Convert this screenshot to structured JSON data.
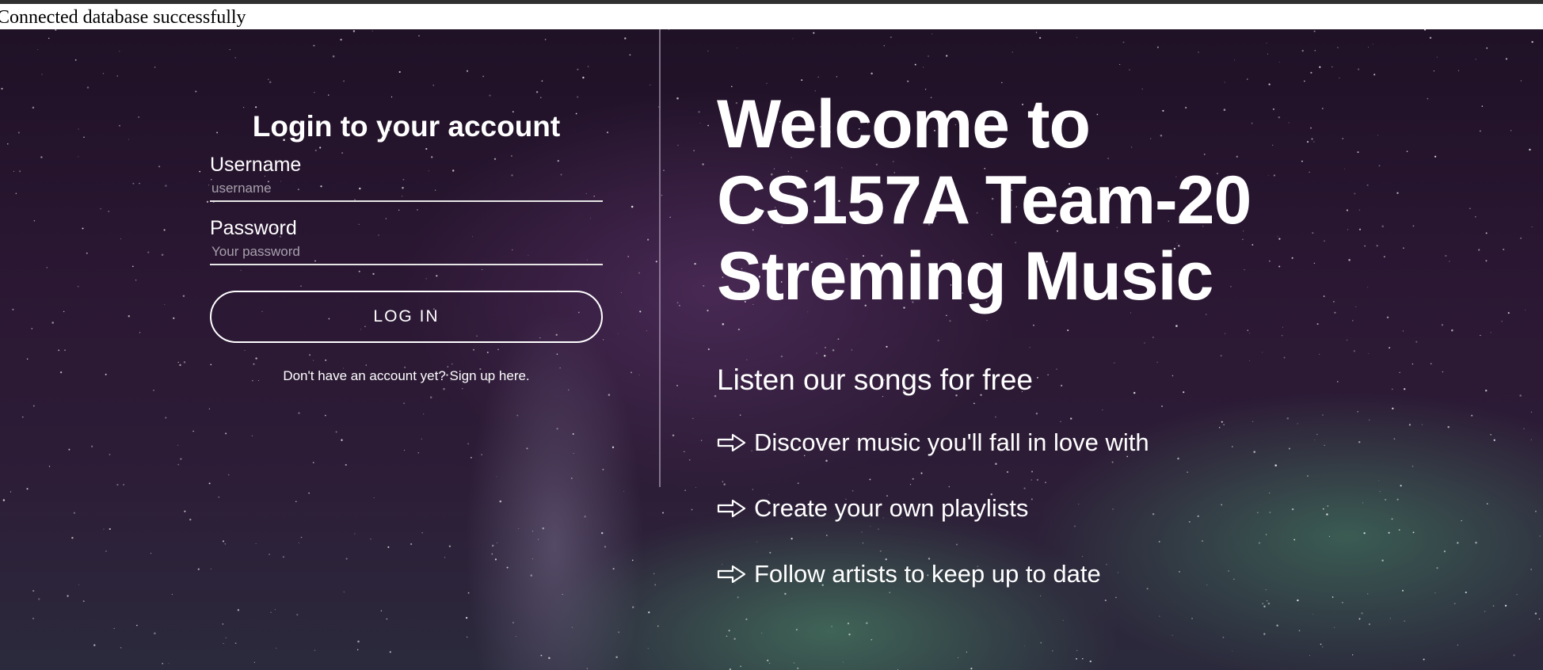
{
  "status": {
    "message": "Connected database successfully"
  },
  "login": {
    "title": "Login to your account",
    "username_label": "Username",
    "username_placeholder": "username",
    "password_label": "Password",
    "password_placeholder": "Your password",
    "button_label": "LOG IN",
    "signup_text": "Don't have an account yet? Sign up here."
  },
  "welcome": {
    "heading_lines": [
      "Welcome to",
      "CS157A Team-20",
      "Streming Music"
    ],
    "tagline": "Listen our songs for free",
    "features": [
      {
        "icon": "right-arrow-outline-icon",
        "text": "Discover music you'll fall in love with"
      },
      {
        "icon": "right-arrow-outline-icon",
        "text": "Create your own playlists"
      },
      {
        "icon": "right-arrow-outline-icon",
        "text": "Follow artists to keep up to date"
      }
    ]
  },
  "colors": {
    "text": "#ffffff",
    "sky_dark": "#1f1126",
    "sky_purple": "#5f376e",
    "aurora_green": "#50966e",
    "status_bar": "#303030"
  }
}
